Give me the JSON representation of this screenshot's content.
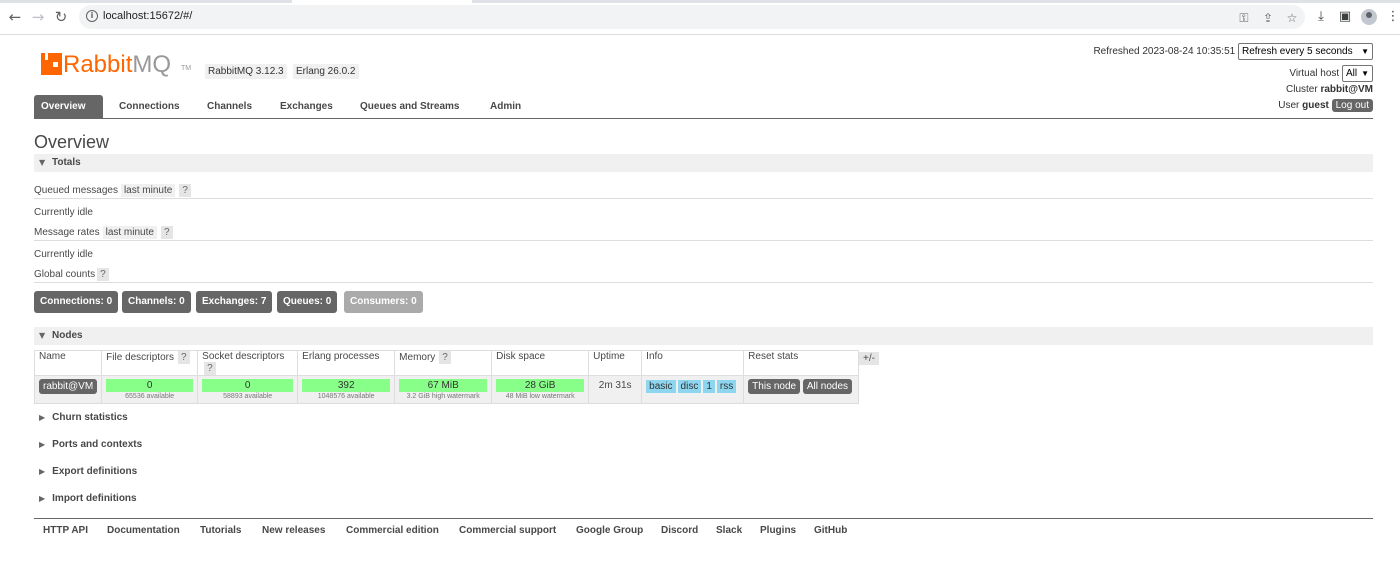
{
  "browser": {
    "url": "localhost:15672/#/"
  },
  "header": {
    "logo_rabbit": "Rabbit",
    "logo_mq": "MQ",
    "logo_tm": "TM",
    "rabbitmq_version": "RabbitMQ 3.12.3",
    "erlang_version": "Erlang 26.0.2",
    "refreshed_label": "Refreshed 2023-08-24 10:35:51",
    "refresh_select": "Refresh every 5 seconds",
    "vhost_label": "Virtual host",
    "vhost_select": "All",
    "cluster_label": "Cluster",
    "cluster_name": "rabbit@VM",
    "user_label": "User",
    "user_name": "guest",
    "logout": "Log out"
  },
  "tabs": [
    "Overview",
    "Connections",
    "Channels",
    "Exchanges",
    "Queues and Streams",
    "Admin"
  ],
  "page_title": "Overview",
  "totals": {
    "heading": "Totals",
    "queued_messages": "Queued messages",
    "queued_range": "last minute",
    "help": "?",
    "idle1": "Currently idle",
    "message_rates": "Message rates",
    "rates_range": "last minute",
    "idle2": "Currently idle",
    "global_counts": "Global counts",
    "counts": [
      {
        "label": "Connections:",
        "value": "0"
      },
      {
        "label": "Channels:",
        "value": "0"
      },
      {
        "label": "Exchanges:",
        "value": "7"
      },
      {
        "label": "Queues:",
        "value": "0"
      },
      {
        "label": "Consumers:",
        "value": "0"
      }
    ]
  },
  "nodes": {
    "heading": "Nodes",
    "columns": [
      "Name",
      "File descriptors",
      "Socket descriptors",
      "Erlang processes",
      "Memory",
      "Disk space",
      "Uptime",
      "Info",
      "Reset stats"
    ],
    "row": {
      "name": "rabbit@VM",
      "fd": "0",
      "fd_sub": "65536 available",
      "sd": "0",
      "sd_sub": "58893 available",
      "ep": "392",
      "ep_sub": "1048576 available",
      "mem": "67 MiB",
      "mem_sub": "3.2 GiB high watermark",
      "disk": "28 GiB",
      "disk_sub": "48 MiB low watermark",
      "uptime": "2m 31s",
      "info_tags": [
        "basic",
        "disc",
        "1",
        "rss"
      ],
      "reset_this": "This node",
      "reset_all": "All nodes"
    },
    "plus_minus": "+/-"
  },
  "collapsed_sections": [
    "Churn statistics",
    "Ports and contexts",
    "Export definitions",
    "Import definitions"
  ],
  "footer_links": [
    "HTTP API",
    "Documentation",
    "Tutorials",
    "New releases",
    "Commercial edition",
    "Commercial support",
    "Google Group",
    "Discord",
    "Slack",
    "Plugins",
    "GitHub"
  ]
}
